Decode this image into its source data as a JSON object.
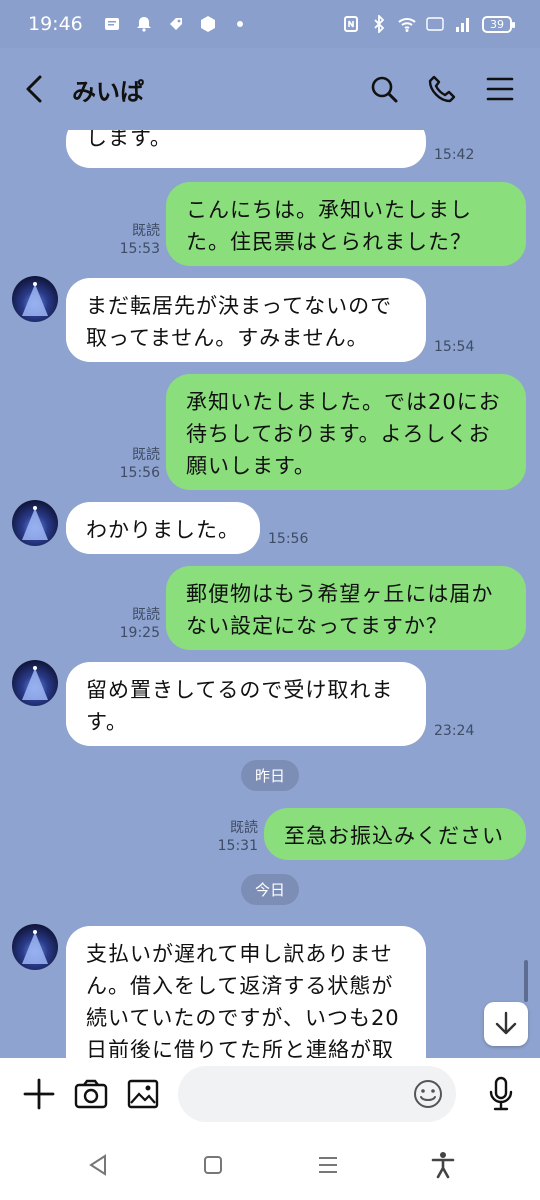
{
  "status_bar": {
    "time": "19:46",
    "battery": "39"
  },
  "header": {
    "title": "みいぱ"
  },
  "messages": [
    {
      "type": "in",
      "text": "します。",
      "time": "15:42"
    },
    {
      "type": "out",
      "text": "こんにちは。承知いたしました。住民票はとられました？",
      "read": "既読",
      "time": "15:53"
    },
    {
      "type": "in",
      "text": "まだ転居先が決まってないので取ってません。すみません。",
      "time": "15:54"
    },
    {
      "type": "out",
      "text": "承知いたしました。では20にお待ちしております。よろしくお願いします。",
      "read": "既読",
      "time": "15:56"
    },
    {
      "type": "in",
      "text": "わかりました。",
      "time": "15:56"
    },
    {
      "type": "out",
      "text": "郵便物はもう希望ヶ丘には届かない設定になってますか？",
      "read": "既読",
      "time": "19:25"
    },
    {
      "type": "in",
      "text": "留め置きしてるので受け取れます。",
      "time": "23:24"
    },
    {
      "type": "out",
      "text": "至急お振込みください",
      "read": "既読",
      "time": "15:31"
    },
    {
      "type": "in",
      "text": "支払いが遅れて申し訳ありません。借入をして返済する状態が続いていたのですが、いつも20日前後に借りてた所と連絡が取"
    }
  ],
  "dates": {
    "yesterday": "昨日",
    "today": "今日"
  },
  "input": {
    "placeholder": ""
  },
  "colors": {
    "background": "#8ea3cf",
    "bubble_out": "#8bde7c",
    "bubble_in": "#ffffff"
  },
  "icons": [
    "back-icon",
    "search-icon",
    "phone-icon",
    "menu-icon",
    "plus-icon",
    "camera-icon",
    "image-icon",
    "emoji-icon",
    "mic-icon",
    "arrow-down-icon"
  ]
}
